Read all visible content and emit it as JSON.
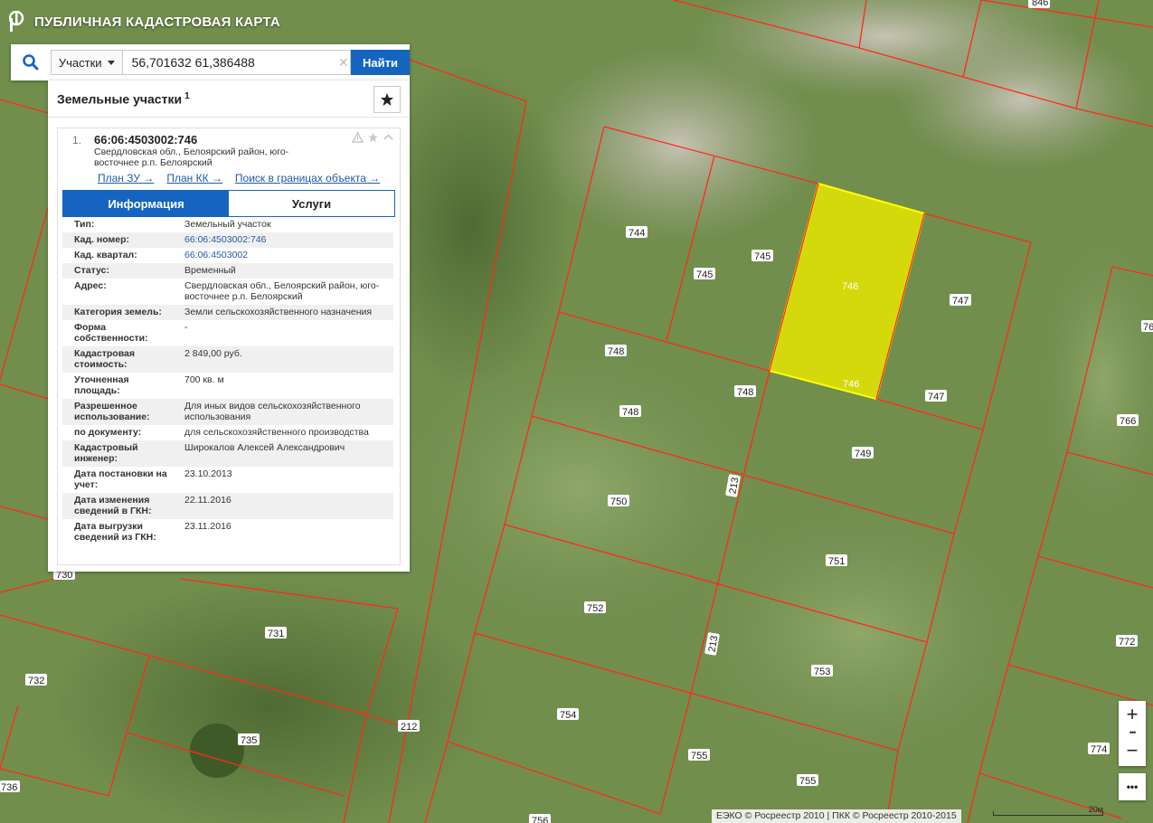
{
  "app": {
    "title": "ПУБЛИЧНАЯ КАДАСТРОВАЯ КАРТА"
  },
  "search": {
    "type_label": "Участки",
    "query": "56,701632 61,386488",
    "clear_glyph": "✕",
    "find_label": "Найти"
  },
  "results": {
    "title": "Земельные участки",
    "count": "1",
    "item": {
      "index": "1.",
      "cad_number": "66:06:4503002:746",
      "address_short": "Свердловская обл., Белоярский район, юго-восточнее р.п. Белоярский",
      "links": {
        "plan_zu": "План ЗУ →",
        "plan_kk": "План КК →",
        "search_bounds": "Поиск в границах объекта →"
      },
      "tabs": {
        "info": "Информация",
        "services": "Услуги"
      },
      "fields": [
        {
          "key": "Тип:",
          "value": "Земельный участок",
          "link": false
        },
        {
          "key": "Кад. номер:",
          "value": "66:06:4503002:746",
          "link": true
        },
        {
          "key": "Кад. квартал:",
          "value": "66:06:4503002",
          "link": true
        },
        {
          "key": "Статус:",
          "value": "Временный",
          "link": false
        },
        {
          "key": "Адрес:",
          "value": "Свердловская обл., Белоярский район, юго-восточнее р.п. Белоярский",
          "link": false
        },
        {
          "key": "Категория земель:",
          "value": "Земли сельскохозяйственного назначения",
          "link": false
        },
        {
          "key": "Форма собственности:",
          "value": "-",
          "link": false
        },
        {
          "key": "Кадастровая стоимость:",
          "value": "2 849,00 руб.",
          "link": false
        },
        {
          "key": "Уточненная площадь:",
          "value": "700 кв. м",
          "link": false
        },
        {
          "key": "Разрешенное использование:",
          "value": "Для иных видов сельскохозяйственного использования",
          "link": false
        },
        {
          "key": "по документу:",
          "value": "для сельскохозяйственного производства",
          "link": false
        },
        {
          "key": "Кадастровый инженер:",
          "value": "Широкалов Алексей Александрович",
          "link": false
        },
        {
          "key": "Дата постановки на учет:",
          "value": "23.10.2013",
          "link": false
        },
        {
          "key": "Дата изменения сведений в ГКН:",
          "value": "22.11.2016",
          "link": false
        },
        {
          "key": "Дата выгрузки сведений из ГКН:",
          "value": "23.11.2016",
          "link": false
        }
      ]
    }
  },
  "map": {
    "parcel_labels": [
      "846",
      "744",
      "745",
      "745",
      "746",
      "746",
      "747",
      "747",
      "748",
      "748",
      "748",
      "749",
      "750",
      "751",
      "752",
      "753",
      "754",
      "755",
      "755",
      "756",
      "730",
      "731",
      "732",
      "735",
      "736",
      "212",
      "213",
      "213",
      "766",
      "772",
      "774",
      "76"
    ],
    "highlight_color": "#e5e600",
    "boundary_color": "#ff2a1a"
  },
  "controls": {
    "zoom_in": "+",
    "zoom_dots": "•••",
    "zoom_out": "−",
    "more": "•••"
  },
  "attribution": "ЕЭКО © Росреестр 2010 | ПКК © Росреестр 2010-2015",
  "scale_label": "20м"
}
